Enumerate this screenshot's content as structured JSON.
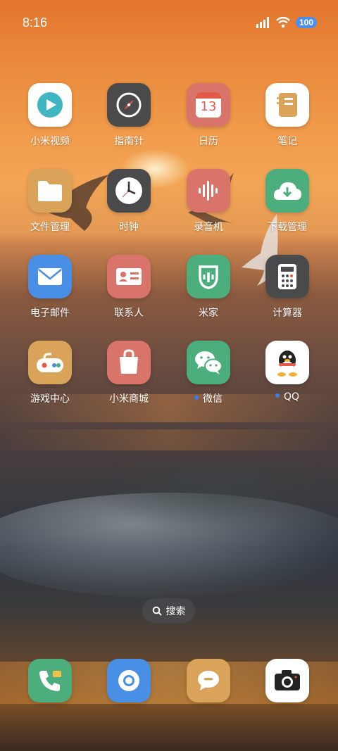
{
  "status_bar": {
    "time": "8:16",
    "battery": "100"
  },
  "apps": [
    {
      "label": "小米视频"
    },
    {
      "label": "指南针"
    },
    {
      "label": "日历",
      "calendar_day": "13"
    },
    {
      "label": "笔记"
    },
    {
      "label": "文件管理"
    },
    {
      "label": "时钟"
    },
    {
      "label": "录音机"
    },
    {
      "label": "下载管理"
    },
    {
      "label": "电子邮件"
    },
    {
      "label": "联系人"
    },
    {
      "label": "米家"
    },
    {
      "label": "计算器"
    },
    {
      "label": "游戏中心"
    },
    {
      "label": "小米商城"
    },
    {
      "label": "微信",
      "notification_dot": true
    },
    {
      "label": "QQ",
      "notification_dot": true
    }
  ],
  "search": {
    "label": "搜索"
  },
  "dock": [
    {
      "icon": "phone-icon"
    },
    {
      "icon": "browser-icon"
    },
    {
      "icon": "messages-icon"
    },
    {
      "icon": "camera-icon"
    }
  ],
  "colors": {
    "notification_dot": "#3c7dea",
    "battery": "#4a8ff0"
  }
}
